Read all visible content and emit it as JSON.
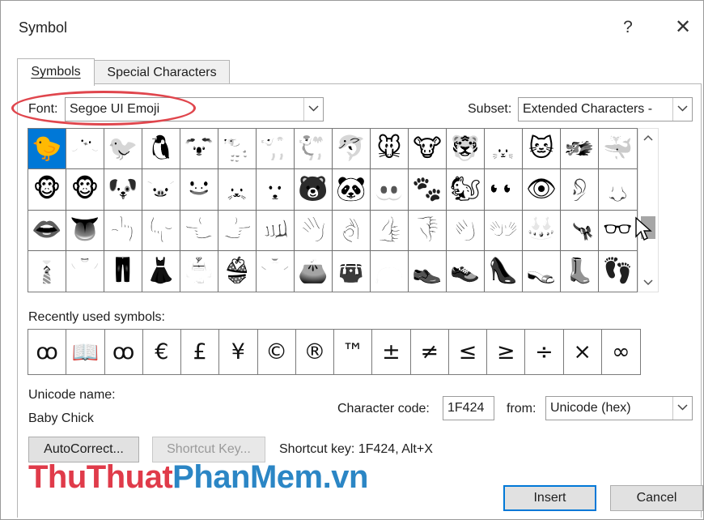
{
  "window": {
    "title": "Symbol",
    "help": "?",
    "close": "✕"
  },
  "tabs": [
    {
      "label": "Symbols",
      "active": true
    },
    {
      "label": "Special Characters",
      "active": false
    }
  ],
  "font": {
    "label": "Font:",
    "value": "Segoe UI Emoji"
  },
  "subset": {
    "label": "Subset:",
    "value": "Extended Characters -"
  },
  "symbols": [
    "🐤",
    "🐣",
    "🐦",
    "🐧",
    "🐨",
    "🐩",
    "🐪",
    "🐫",
    "🐬",
    "🐭",
    "🐮",
    "🐯",
    "🐰",
    "🐱",
    "🐲",
    "🐳",
    "🐵",
    "🐵",
    "🐶",
    "🐷",
    "🐸",
    "🐹",
    "🐺",
    "🐻",
    "🐼",
    "🐽",
    "🐾",
    "🐿",
    "👀",
    "👁",
    "👂",
    "👃",
    "👄",
    "👅",
    "👆",
    "👇",
    "👈",
    "👉",
    "👊",
    "👋",
    "👌",
    "👍",
    "👎",
    "👏",
    "👐",
    "👑",
    "👒",
    "👓",
    "👔",
    "👕",
    "👖",
    "👗",
    "👘",
    "👙",
    "👚",
    "👛",
    "👜",
    "👝",
    "👞",
    "👟",
    "👠",
    "👡",
    "👢",
    "👣"
  ],
  "recent": {
    "label": "Recently used symbols:",
    "items": [
      "ꝏ",
      "📖",
      "ꝏ",
      "€",
      "£",
      "¥",
      "©",
      "®",
      "™",
      "±",
      "≠",
      "≤",
      "≥",
      "÷",
      "×",
      "∞"
    ]
  },
  "unicode": {
    "label": "Unicode name:",
    "value": "Baby Chick"
  },
  "charcode": {
    "label": "Character code:",
    "value": "1F424"
  },
  "from": {
    "label": "from:",
    "value": "Unicode (hex)"
  },
  "buttons": {
    "autocorrect": "AutoCorrect...",
    "shortcut_key": "Shortcut Key...",
    "insert": "Insert",
    "cancel": "Cancel"
  },
  "shortcut_text": "Shortcut key: 1F424, Alt+X",
  "watermark": {
    "part1": "ThuThuat",
    "part2": "PhanMem.vn"
  },
  "colors": {
    "selection": "#0078d7",
    "highlight_ring": "#e0464d",
    "watermark_red": "#e03b4a",
    "watermark_blue": "#2b86c5"
  }
}
